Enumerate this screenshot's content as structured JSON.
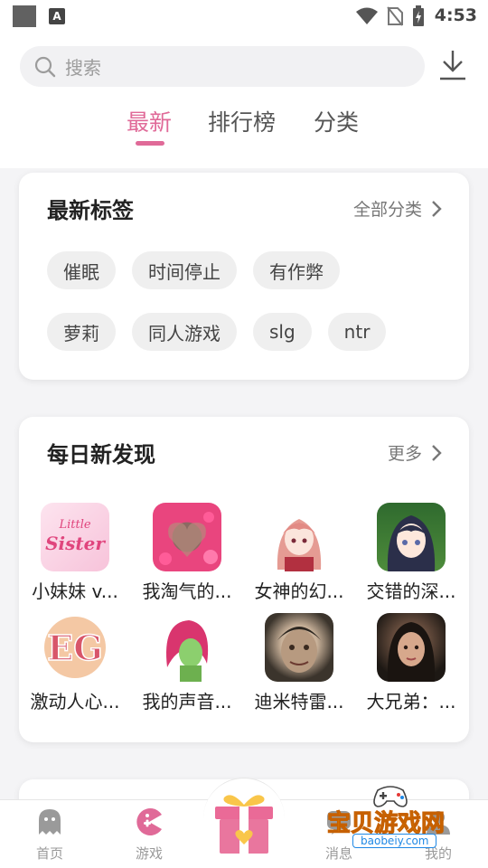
{
  "status_bar": {
    "time": "4:53",
    "a_label": "A"
  },
  "search": {
    "placeholder": "搜索"
  },
  "tabs": [
    {
      "label": "最新",
      "active": true
    },
    {
      "label": "排行榜",
      "active": false
    },
    {
      "label": "分类",
      "active": false
    }
  ],
  "tags_card": {
    "title": "最新标签",
    "more_label": "全部分类",
    "tags_row1": [
      "催眠",
      "时间停止",
      "有作弊"
    ],
    "tags_row2": [
      "萝莉",
      "同人游戏",
      "slg",
      "ntr"
    ]
  },
  "daily_card": {
    "title": "每日新发现",
    "more_label": "更多",
    "games": [
      {
        "name": "小妹妹 v...",
        "thumb_text": "Little Sister"
      },
      {
        "name": "我淘气的..."
      },
      {
        "name": "女神的幻..."
      },
      {
        "name": "交错的深..."
      },
      {
        "name": "激动人心...",
        "thumb_text": "EG"
      },
      {
        "name": "我的声音..."
      },
      {
        "name": "迪米特雷..."
      },
      {
        "name": "大兄弟：..."
      }
    ]
  },
  "bottom_nav": [
    {
      "label": "首页",
      "icon": "ghost-icon",
      "active": false
    },
    {
      "label": "游戏",
      "icon": "pacman-icon",
      "active": true
    },
    {
      "label": "消息",
      "icon": "message-icon",
      "active": false
    },
    {
      "label": "我的",
      "icon": "user-icon",
      "active": false
    }
  ],
  "watermark": {
    "text": "宝贝游戏网",
    "url": "baobeiy.com"
  },
  "colors": {
    "accent": "#e06a98",
    "background": "#f4f4f6"
  }
}
